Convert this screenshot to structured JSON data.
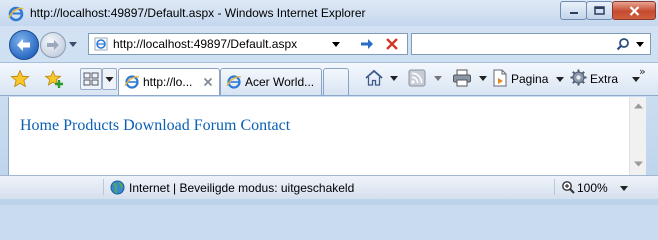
{
  "window": {
    "title": "http://localhost:49897/Default.aspx - Windows Internet Explorer"
  },
  "address_bar": {
    "url": "http://localhost:49897/Default.aspx"
  },
  "search_box": {
    "value": ""
  },
  "tabs": [
    {
      "label": "http://lo...",
      "active": true
    },
    {
      "label": "Acer World...",
      "active": false
    }
  ],
  "command_bar": {
    "page_label": "Pagina",
    "tools_label": "Extra"
  },
  "content": {
    "nav_links": [
      "Home",
      "Products",
      "Download",
      "Forum",
      "Contact"
    ]
  },
  "status_bar": {
    "zone": "Internet | Beveiligde modus: uitgeschakeld",
    "zoom": "100%"
  },
  "colors": {
    "link": "#0b5fb5",
    "frame": "#c9dcef",
    "close_button": "#c54a2e"
  },
  "icons": [
    "ie-page-icon",
    "back-arrow-icon",
    "forward-arrow-icon",
    "go-arrow-icon",
    "stop-icon",
    "search-icon",
    "favorites-star-icon",
    "add-favorites-icon",
    "quick-tabs-icon",
    "home-icon",
    "feeds-icon",
    "print-icon",
    "page-icon",
    "tools-gear-icon",
    "globe-icon",
    "zoom-icon"
  ]
}
